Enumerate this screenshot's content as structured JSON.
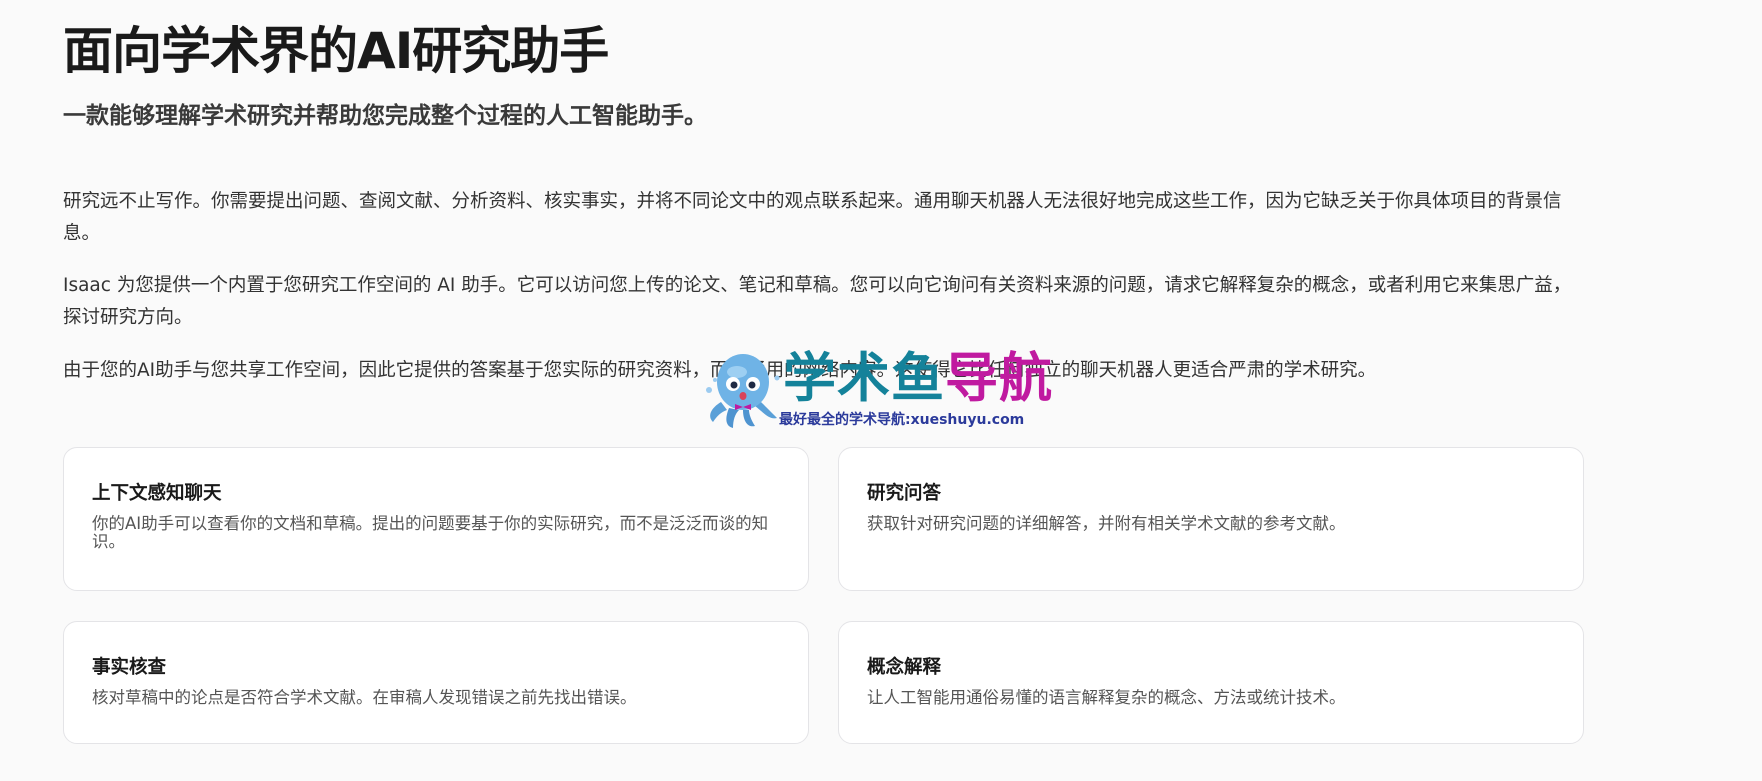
{
  "header": {
    "title": "面向学术界的AI研究助手",
    "subtitle": "一款能够理解学术研究并帮助您完成整个过程的人工智能助手。"
  },
  "paragraphs": [
    "研究远不止写作。你需要提出问题、查阅文献、分析资料、核实事实，并将不同论文中的观点联系起来。通用聊天机器人无法很好地完成这些工作，因为它缺乏关于你具体项目的背景信息。",
    "Isaac 为您提供一个内置于您研究工作空间的 AI 助手。它可以访问您上传的论文、笔记和草稿。您可以向它询问有关资料来源的问题，请求它解释复杂的概念，或者利用它来集思广益，探讨研究方向。",
    "由于您的AI助手与您共享工作空间，因此它提供的答案基于您实际的研究资料，而非通用的网络内容。这使得它比任何独立的聊天机器人更适合严肃的学术研究。"
  ],
  "features": [
    {
      "title": "上下文感知聊天",
      "description": "你的AI助手可以查看你的文档和草稿。提出的问题要基于你的实际研究，而不是泛泛而谈的知识。"
    },
    {
      "title": "研究问答",
      "description": "获取针对研究问题的详细解答，并附有相关学术文献的参考文献。"
    },
    {
      "title": "事实核查",
      "description": "核对草稿中的论点是否符合学术文献。在审稿人发现错误之前先找出错误。"
    },
    {
      "title": "概念解释",
      "description": "让人工智能用通俗易懂的语言解释复杂的概念、方法或统计技术。"
    }
  ],
  "watermark": {
    "brand_part1": "学术鱼",
    "brand_part2": "导航",
    "slogan": "最好最全的学术导航:xueshuyu.com",
    "mascot_icon": "octopus-mascot-icon",
    "colors": {
      "brand_part1": "#14829a",
      "brand_part2": "#c01aa0",
      "slogan": "#2b3a9b"
    }
  }
}
